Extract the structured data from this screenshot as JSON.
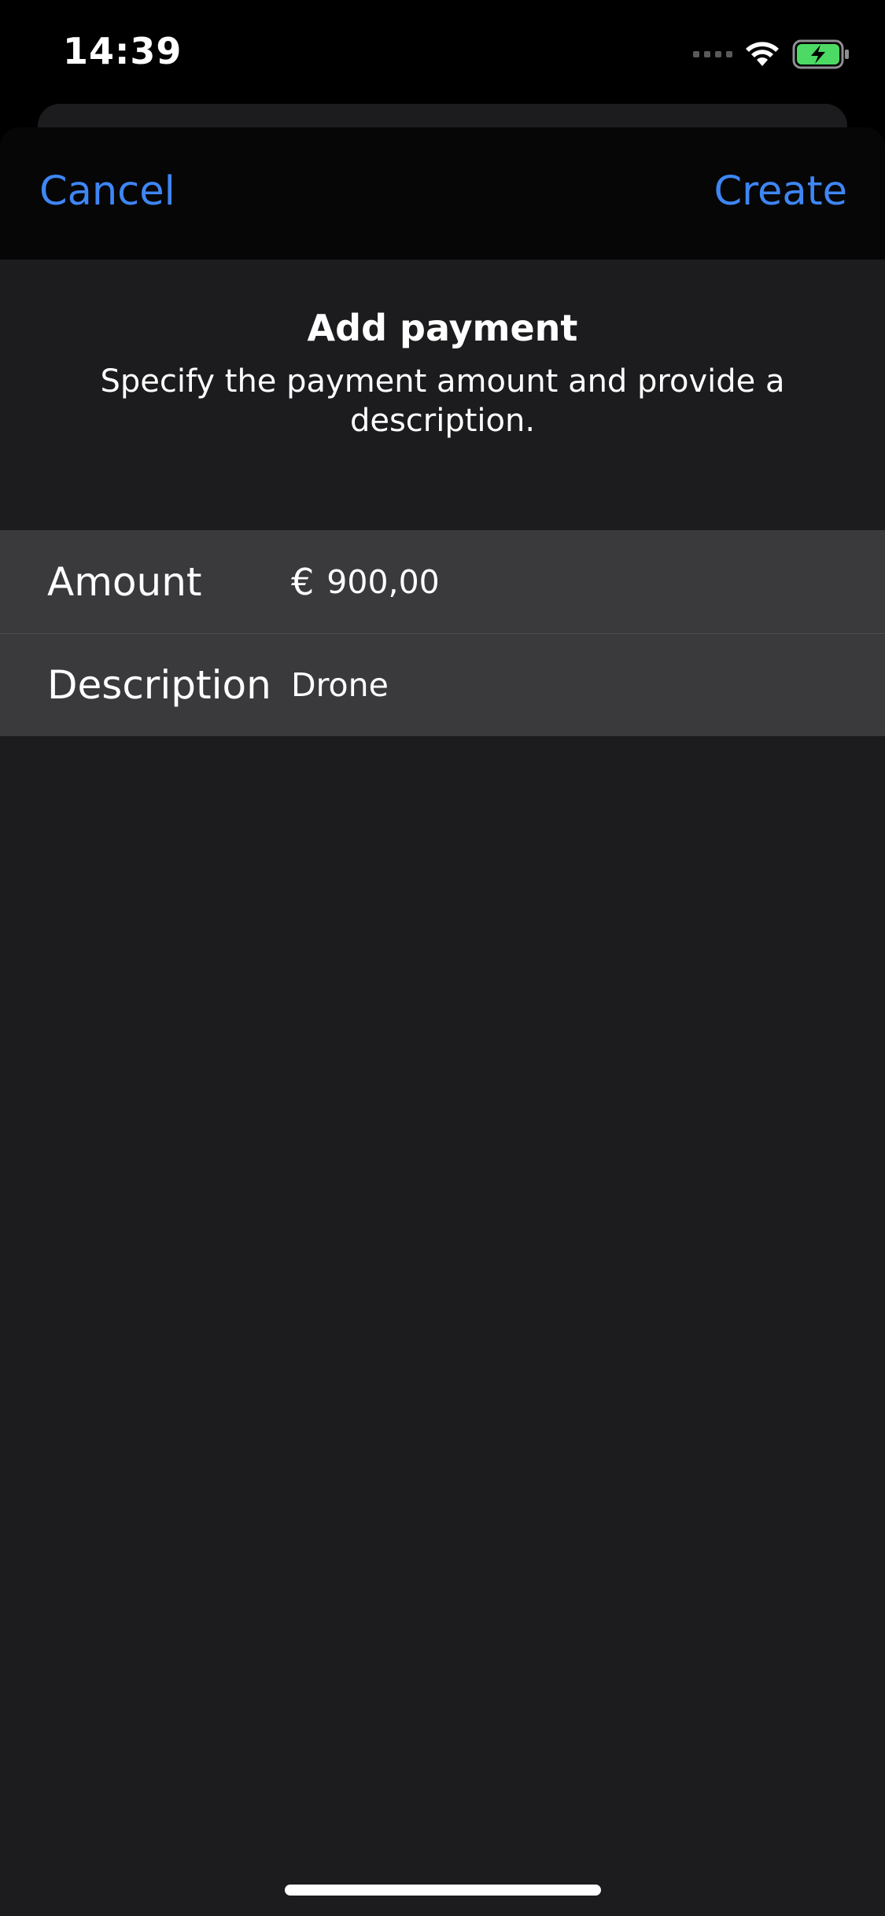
{
  "status_bar": {
    "time": "14:39",
    "icons": [
      "signal-icon",
      "wifi-icon",
      "battery-charging-icon"
    ],
    "battery_color": "#4cd964"
  },
  "nav": {
    "cancel_label": "Cancel",
    "create_label": "Create",
    "accent_color": "#3e86f5"
  },
  "header": {
    "title": "Add payment",
    "subtitle": "Specify the payment amount and provide a description."
  },
  "form": {
    "amount": {
      "label": "Amount",
      "currency_symbol": "€",
      "value": "900,00"
    },
    "description": {
      "label": "Description",
      "value": "Drone"
    }
  }
}
